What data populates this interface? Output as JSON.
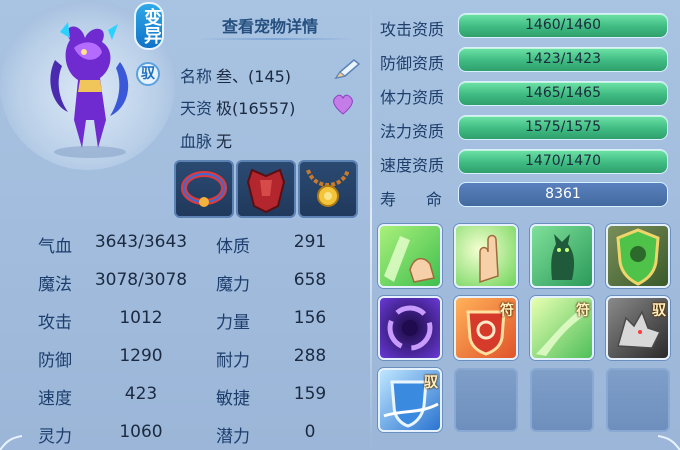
{
  "pet": {
    "mutant_badge": "变异",
    "tame_badge": "驭",
    "detail_link": "查看宠物详情",
    "name_label": "名称",
    "name_value": "叁、(145)",
    "talent_label": "天资",
    "talent_value": "极(16557)",
    "bloodline_label": "血脉",
    "bloodline_value": "无"
  },
  "equipment": [
    "necklace-collar-icon",
    "armor-icon",
    "amulet-icon"
  ],
  "stats": {
    "hp_label": "气血",
    "hp_value": "3643/3643",
    "mp_label": "魔法",
    "mp_value": "3078/3078",
    "atk_label": "攻击",
    "atk_value": "1012",
    "def_label": "防御",
    "def_value": "1290",
    "spd_label": "速度",
    "spd_value": "423",
    "spi_label": "灵力",
    "spi_value": "1060",
    "con_label": "体质",
    "con_value": "291",
    "mag_label": "魔力",
    "mag_value": "658",
    "str_label": "力量",
    "str_value": "156",
    "end_label": "耐力",
    "end_value": "288",
    "agi_label": "敏捷",
    "agi_value": "159",
    "pot_label": "潜力",
    "pot_value": "0"
  },
  "aptitudes": [
    {
      "label": "攻击资质",
      "value": "1460/1460",
      "fill": 1.0
    },
    {
      "label": "防御资质",
      "value": "1423/1423",
      "fill": 1.0
    },
    {
      "label": "体力资质",
      "value": "1465/1465",
      "fill": 1.0
    },
    {
      "label": "法力资质",
      "value": "1575/1575",
      "fill": 1.0
    },
    {
      "label": "速度资质",
      "value": "1470/1470",
      "fill": 1.0
    }
  ],
  "life": {
    "label": "寿命",
    "value": "8361"
  },
  "skills": {
    "row1": [
      "green-hand-icon",
      "green-palm-icon",
      "green-cat-icon",
      "green-shield-icon"
    ],
    "row2": [
      "purple-vortex-icon",
      "red-rune-icon",
      "green-rune-icon",
      "gray-wolf-icon"
    ],
    "row3": [
      "blue-shield-icon"
    ],
    "tags": {
      "fu": "符",
      "yu": "驭"
    }
  },
  "colors": {
    "accent": "#3fbb82",
    "panel": "#a9c3e2",
    "label": "#1e3f6b"
  }
}
